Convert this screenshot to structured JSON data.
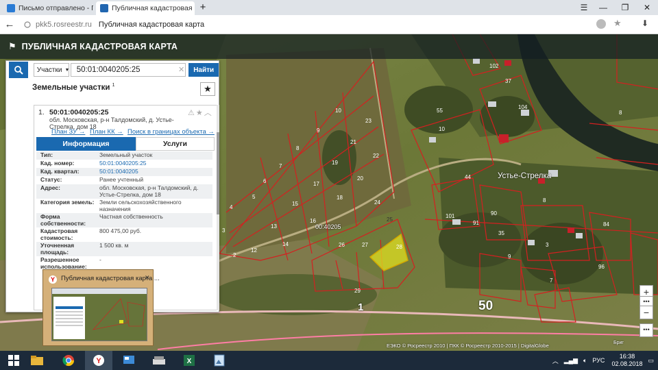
{
  "browser": {
    "tabs": [
      {
        "label": "Письмо отправлено - Почт",
        "active": false
      },
      {
        "label": "Публичная кадастровая ка",
        "active": true
      }
    ],
    "url_domain": "pkk5.rosreestr.ru",
    "url_title": "Публичная кадастровая карта"
  },
  "app": {
    "title": "ПУБЛИЧНАЯ КАДАСТРОВАЯ КАРТА"
  },
  "search": {
    "type_label": "Участки",
    "query": "50:01:0040205:25",
    "button_label": "Найти"
  },
  "results": {
    "title": "Земельные участки",
    "count": "1",
    "item": {
      "number": "1.",
      "cad_number": "50:01:0040205:25",
      "address": "обл. Московская, р-н Талдомский, д. Устье-Стрелка, дом 18",
      "links": [
        "План ЗУ →",
        "План КК →",
        "Поиск в границах объекта →"
      ],
      "tabs": [
        "Информация",
        "Услуги"
      ],
      "rows": [
        {
          "key": "Тип:",
          "value": "Земельный участок"
        },
        {
          "key": "Кад. номер:",
          "value": "50:01:0040205:25"
        },
        {
          "key": "Кад. квартал:",
          "value": "50:01:0040205"
        },
        {
          "key": "Статус:",
          "value": "Ранее учтенный"
        },
        {
          "key": "Адрес:",
          "value": "обл. Московская, р-н Талдомский, д. Устье-Стрелка, дом 18"
        },
        {
          "key": "Категория земель:",
          "value": "Земли сельскохозяйственного назначения"
        },
        {
          "key": "Форма собственности:",
          "value": "Частная собственность"
        },
        {
          "key": "Кадастровая стоимость:",
          "value": "800 475,00 руб."
        },
        {
          "key": "Уточненная площадь:",
          "value": "1 500 кв. м"
        },
        {
          "key": "Разрешенное использование:",
          "value": "-"
        }
      ]
    }
  },
  "thumbnail": {
    "title": "Публичная кадастровая карта ..."
  },
  "map": {
    "labels": {
      "village": "Устье-Стрелка",
      "quarter_code": "00:40205",
      "big_50": "50",
      "big_1": "1",
      "parcels": [
        "10",
        "9",
        "23",
        "8",
        "21",
        "22",
        "7",
        "19",
        "6",
        "17",
        "20",
        "5",
        "15",
        "18",
        "24",
        "4",
        "13",
        "16",
        "26",
        "27",
        "28",
        "3",
        "12",
        "14",
        "2",
        "25",
        "29",
        "55",
        "10",
        "44",
        "101",
        "91",
        "96",
        "8",
        "84",
        "90",
        "35",
        "9",
        "7",
        "8",
        "3",
        "102",
        "37",
        "104"
      ]
    },
    "attribution": "ЕЭКО © Росреестр 2010 | ПКК © Росреестр 2010-2015 | DigitalGlobe",
    "brand_small": "Бриг",
    "highlight_color": "#e0e020",
    "boundary_color": "#d42020"
  },
  "taskbar": {
    "time": "16:38",
    "date": "02.08.2018",
    "lang": "РУС"
  }
}
